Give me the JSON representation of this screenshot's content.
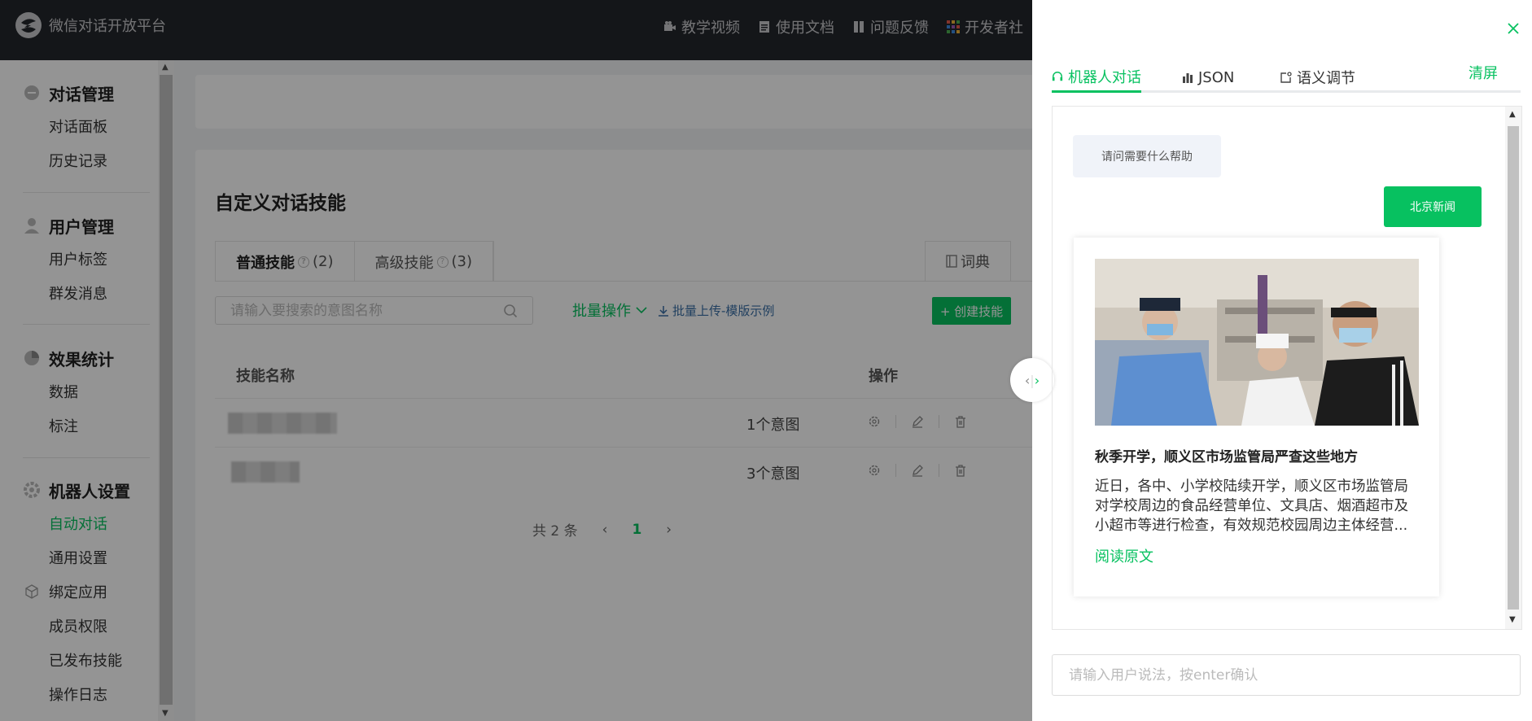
{
  "header": {
    "brand": "微信对话开放平台",
    "nav": [
      {
        "label": "教学视频",
        "icon": "video-icon"
      },
      {
        "label": "使用文档",
        "icon": "document-icon"
      },
      {
        "label": "问题反馈",
        "icon": "feedback-icon"
      },
      {
        "label": "开发者社",
        "icon": "community-icon"
      }
    ]
  },
  "sidebar": {
    "groups": [
      {
        "title": "对话管理",
        "icon": "dialog-icon",
        "items": [
          "对话面板",
          "历史记录"
        ]
      },
      {
        "title": "用户管理",
        "icon": "user-icon",
        "items": [
          "用户标签",
          "群发消息"
        ]
      },
      {
        "title": "效果统计",
        "icon": "pie-chart-icon",
        "items": [
          "数据",
          "标注"
        ]
      },
      {
        "title": "机器人设置",
        "icon": "gear-icon",
        "items": [
          "自动对话",
          "通用设置",
          "绑定应用",
          "成员权限",
          "已发布技能",
          "操作日志"
        ]
      }
    ],
    "active_item": "自动对话"
  },
  "main": {
    "title": "自定义对话技能",
    "tabs": [
      {
        "label": "普通技能",
        "count": "(2)"
      },
      {
        "label": "高级技能",
        "count": "(3)"
      }
    ],
    "dict_label": "词典",
    "search_placeholder": "请输入要搜索的意图名称",
    "batch_label": "批量操作",
    "upload_label": "批量上传-模版示例",
    "create_label": "+ 创建技能",
    "columns": {
      "name": "技能名称",
      "ops": "操作"
    },
    "rows": [
      {
        "intents": "1个意图"
      },
      {
        "intents": "3个意图"
      }
    ],
    "pagination": {
      "total": "共 2 条",
      "current": "1"
    }
  },
  "drawer": {
    "tabs": [
      {
        "label": "机器人对话",
        "icon": "headset-icon"
      },
      {
        "label": "JSON",
        "icon": "bar-chart-icon"
      },
      {
        "label": "语义调节",
        "icon": "adjust-icon"
      }
    ],
    "clear_label": "清屏",
    "bot_message": "请问需要什么帮助",
    "user_message": "北京新闻",
    "news": {
      "title": "秋季开学，顺义区市场监管局严查这些地方",
      "desc": "近日，各中、小学校陆续开学，顺义区市场监管局对学校周边的食品经营单位、文具店、烟酒超市及小超市等进行检查，有效规范校园周边主体经营...",
      "link": "阅读原文"
    },
    "input_placeholder": "请输入用户说法，按enter确认"
  },
  "colors": {
    "accent": "#07c160",
    "topbar": "#23262b"
  }
}
